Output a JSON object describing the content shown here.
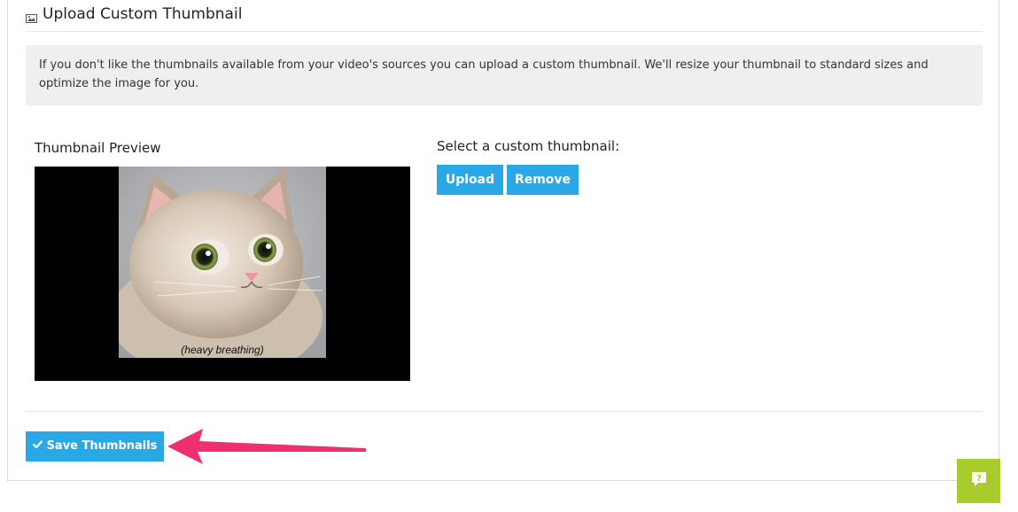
{
  "section": {
    "title": "Upload Custom Thumbnail",
    "title_icon": "image-icon"
  },
  "info": {
    "text": "If you don't like the thumbnails available from your video's sources you can upload a custom thumbnail. We'll resize your thumbnail to standard sizes and optimize the image for you."
  },
  "preview": {
    "label": "Thumbnail Preview",
    "caption": "(heavy breathing)"
  },
  "custom": {
    "label": "Select a custom thumbnail:",
    "upload_label": "Upload",
    "remove_label": "Remove"
  },
  "footer": {
    "save_label": "Save Thumbnails",
    "save_icon": "check-icon"
  },
  "help": {
    "icon": "question-chat-icon"
  },
  "colors": {
    "primary": "#2aa8e5",
    "help": "#a8cc2c",
    "annotation_arrow": "#f0306e"
  }
}
